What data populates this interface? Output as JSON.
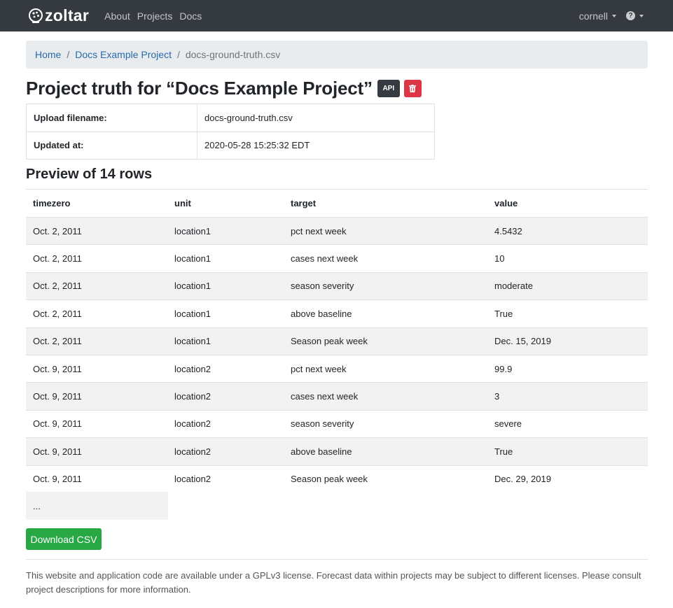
{
  "nav": {
    "brand": "zoltar",
    "links": [
      "About",
      "Projects",
      "Docs"
    ],
    "user": "cornell",
    "help_icon": "question-circle-icon"
  },
  "breadcrumb": {
    "home": "Home",
    "project": "Docs Example Project",
    "current": "docs-ground-truth.csv",
    "separator": "/"
  },
  "title": {
    "text": "Project truth for “Docs Example Project”",
    "api_badge": "API",
    "delete_icon": "trash-icon"
  },
  "info": {
    "upload_label": "Upload filename:",
    "upload_value": "docs-ground-truth.csv",
    "updated_label": "Updated at:",
    "updated_value": "2020-05-28 15:25:32 EDT"
  },
  "preview": {
    "title": "Preview of 14 rows",
    "headers": [
      "timezero",
      "unit",
      "target",
      "value"
    ],
    "rows": [
      [
        "Oct. 2, 2011",
        "location1",
        "pct next week",
        "4.5432"
      ],
      [
        "Oct. 2, 2011",
        "location1",
        "cases next week",
        "10"
      ],
      [
        "Oct. 2, 2011",
        "location1",
        "season severity",
        "moderate"
      ],
      [
        "Oct. 2, 2011",
        "location1",
        "above baseline",
        "True"
      ],
      [
        "Oct. 2, 2011",
        "location1",
        "Season peak week",
        "Dec. 15, 2019"
      ],
      [
        "Oct. 9, 2011",
        "location2",
        "pct next week",
        "99.9"
      ],
      [
        "Oct. 9, 2011",
        "location2",
        "cases next week",
        "3"
      ],
      [
        "Oct. 9, 2011",
        "location2",
        "season severity",
        "severe"
      ],
      [
        "Oct. 9, 2011",
        "location2",
        "above baseline",
        "True"
      ],
      [
        "Oct. 9, 2011",
        "location2",
        "Season peak week",
        "Dec. 29, 2019"
      ]
    ],
    "ellipsis": "..."
  },
  "download_label": "Download CSV",
  "footer": "This website and application code are available under a GPLv3 license. Forecast data within projects may be subject to different licenses. Please consult project descriptions for more information.",
  "colors": {
    "navbar": "#343a40",
    "link": "#2a6aa8",
    "danger": "#dc3545",
    "success": "#28a745",
    "stripe": "#f2f2f2",
    "breadcrumb_bg": "#e9ecef"
  }
}
